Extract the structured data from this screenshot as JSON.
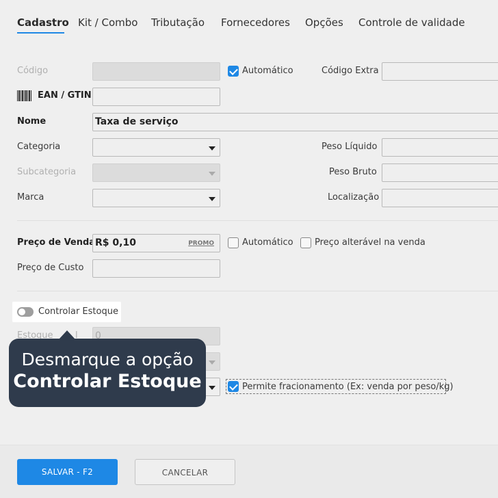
{
  "tabs": [
    "Cadastro",
    "Kit / Combo",
    "Tributação",
    "Fornecedores",
    "Opções",
    "Controle de validade"
  ],
  "form": {
    "codigo_label": "Código",
    "codigo_value": "",
    "automatico_label": "Automático",
    "codigo_extra_label": "Código Extra",
    "ean_label": "EAN / GTIN",
    "nome_label": "Nome",
    "nome_value": "Taxa de serviço",
    "categoria_label": "Categoria",
    "subcategoria_label": "Subcategoria",
    "marca_label": "Marca",
    "peso_liquido_label": "Peso Líquido",
    "peso_bruto_label": "Peso Bruto",
    "localizacao_label": "Localização",
    "preco_venda_label": "Preço de Venda",
    "preco_venda_value": "R$ 0,10",
    "promo_label": "PROMO",
    "preco_automatico_label": "Automático",
    "preco_alteravel_label": "Preço alterável na venda",
    "preco_custo_label": "Preço de Custo",
    "controlar_estoque_label": "Controlar Estoque",
    "estoque_label_partial": "Estoque",
    "estoque_label_partial2": "l",
    "estoque_value": "0",
    "fracionamento_label": "Permite fracionamento (Ex: venda por peso/kg)"
  },
  "tooltip": {
    "line1": "Desmarque a opção",
    "line2": "Controlar Estoque"
  },
  "footer": {
    "save_label": "SALVAR - F2",
    "cancel_label": "CANCELAR"
  },
  "colors": {
    "accent": "#1e88e5",
    "tooltip_bg": "#2f3b4c"
  }
}
